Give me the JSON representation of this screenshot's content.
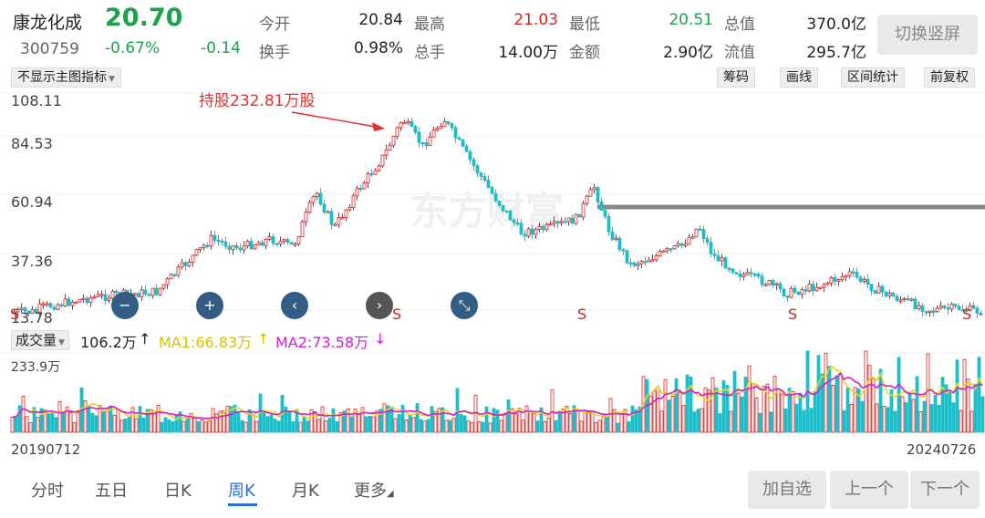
{
  "stock": {
    "name": "康龙化成",
    "price": "20.70",
    "code": "300759",
    "change_pct": "-0.67%",
    "change": "-0.14"
  },
  "stats": {
    "open_label": "今开",
    "open_value": "20.84",
    "high_label": "最高",
    "high_value": "21.03",
    "low_label": "最低",
    "low_value": "20.51",
    "mktcap_label": "总值",
    "mktcap_value": "370.0亿",
    "turnover_label": "换手",
    "turnover_value": "0.98%",
    "volume_label": "总手",
    "volume_value": "14.00万",
    "amount_label": "金额",
    "amount_value": "2.90亿",
    "float_label": "流值",
    "float_value": "295.7亿"
  },
  "switch_button": "切换竖屏",
  "toolbar": {
    "indicator_select": "不显示主图指标",
    "chips": [
      "筹码",
      "画线",
      "区间统计",
      "前复权"
    ]
  },
  "chart_data": {
    "type": "candlestick",
    "y_ticks": [
      "108.11",
      "84.53",
      "60.94",
      "37.36",
      "13.78"
    ],
    "annotation": "持股232.81万股",
    "watermark": "东方财富",
    "sell_marker": "S",
    "volume_panel": {
      "selector": "成交量",
      "volume_value": "106.2万",
      "ma1_label": "MA1:66.83万",
      "ma2_label": "MA2:73.58万",
      "up_arrow": "↑",
      "down_arrow": "↓",
      "max_tick": "233.9万"
    },
    "start_date": "20190712",
    "end_date": "20240726",
    "colors": {
      "up": "#d42020",
      "down": "#22bcc6",
      "ma1": "#e8d820",
      "ma2": "#d020d0",
      "annotation": "#e03030"
    }
  },
  "chart_controls": {
    "zoom_out": "−",
    "zoom_in": "+",
    "prev": "‹",
    "next": "›",
    "collapse": "⤡"
  },
  "bottom": {
    "tabs": [
      "分时",
      "五日",
      "日K",
      "周K",
      "月K",
      "更多"
    ],
    "add_watch": "加自选",
    "prev": "上一个",
    "next": "下一个"
  }
}
